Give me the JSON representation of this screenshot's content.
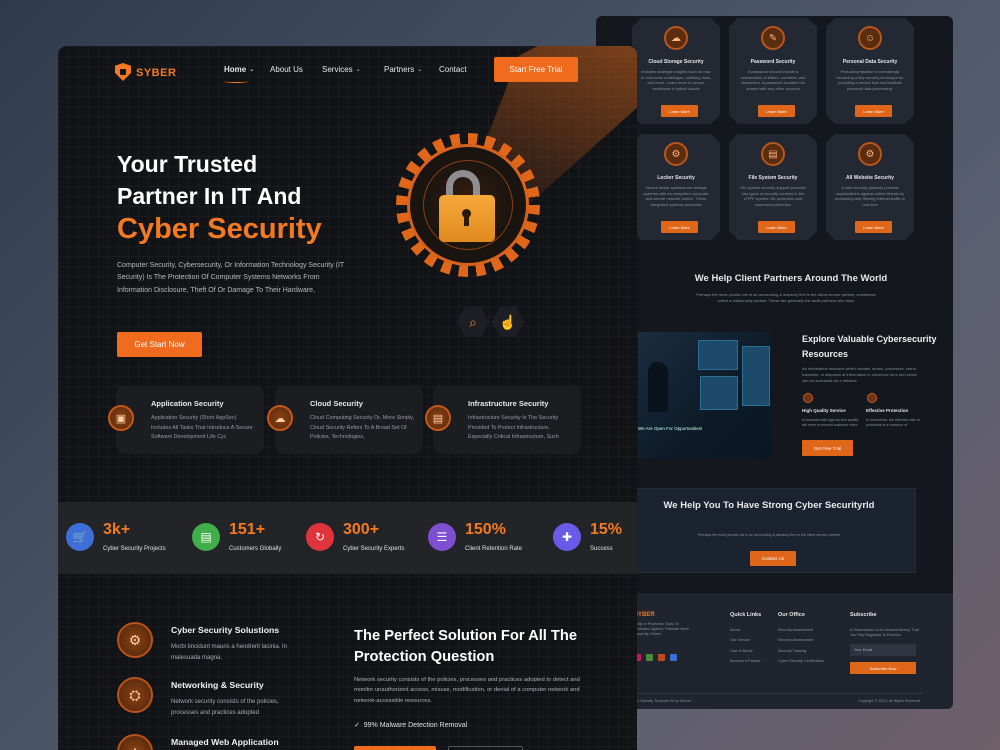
{
  "brand": {
    "name": "SYBER",
    "accent": "#f06b1e"
  },
  "nav": {
    "items": [
      "Home",
      "About Us",
      "Services",
      "Partners",
      "Contact"
    ],
    "cta": "Start Free Trial"
  },
  "hero": {
    "line1": "Your Trusted",
    "line2": "Partner In IT And",
    "line3": "Cyber Security",
    "description": "Computer Security, Cybersecurity, Or Information Technology Security (IT Security) Is The Protection Of Computer Systems Networks From Information Disclosure, Theft Of Or Damage To Their Hardware,",
    "cta": "Get Start Now",
    "icons": [
      "search-icon",
      "pointer-icon"
    ]
  },
  "features": [
    {
      "title": "Application Security",
      "desc": "Application Security (Short AppSec) Includes All Tasks That Introduce A Secure Software Development Life Cyc",
      "icon": "app-icon"
    },
    {
      "title": "Cloud Security",
      "desc": "Cloud Computing Security Or, More Simply, Cloud Security Refers To A Broad Set Of Policies, Technologies,",
      "icon": "cloud-icon"
    },
    {
      "title": "Infrastructure Security",
      "desc": "Infrastructure Security Is The Security Provided To Protect Infrastructure, Especially Critical Infrastructure, Such",
      "icon": "server-icon"
    }
  ],
  "stats": [
    {
      "value": "3k+",
      "label": "Cyber Security Projects",
      "color": "#3e6fd8",
      "icon": "cart-icon"
    },
    {
      "value": "151+",
      "label": "Customers Globally",
      "color": "#3fae4b",
      "icon": "document-icon"
    },
    {
      "value": "300+",
      "label": "Cyber Security Experts",
      "color": "#e0343d",
      "icon": "refresh-icon"
    },
    {
      "value": "150%",
      "label": "Client Retention Rate",
      "color": "#7e4fd0",
      "icon": "list-icon"
    },
    {
      "value": "15%",
      "label": "Success",
      "color": "#6a5ae8",
      "icon": "puzzle-icon"
    }
  ],
  "solutions": [
    {
      "title": "Cyber Security Solustions",
      "desc": "Morbi tincidunt mauris a hendrerit lacinia. In malesuada magna."
    },
    {
      "title": "Networking & Security",
      "desc": "Network security consists of the policies, processes and practices adopted"
    },
    {
      "title": "Managed Web Application",
      "desc": ""
    }
  ],
  "perfect": {
    "title": "The Perfect Solution For All The Protection Question",
    "desc": "Network security consists of the policies, processes and practices adopted to detect and monitor unauthorized access, misuse, modification, or denial of a computer network and network-accessible resources.",
    "check": "99% Malware Detection Removal"
  },
  "back": {
    "services": [
      {
        "title": "Cloud Storage Security",
        "desc": "Includes strategic insights such as how to overcome challenges, outlining risks, and more. Learn more to secure workloads in hybrid clouds"
      },
      {
        "title": "Password Security",
        "desc": "A password should include a combination of letters, numbers, and characters. A password shouldn't be shared with any other account"
      },
      {
        "title": "Personal Data Security",
        "desc": "Pseudonymisation is increasingly becoming a key security technique for providing a means that can facilitate personal data processing."
      },
      {
        "title": "Locker Security",
        "desc": "Secure locker systems are storage systems with an integrated computer and secure network built-in. These integrated systems automate"
      },
      {
        "title": "File System Security",
        "desc": "File system security support provides two types of security controls in the z/TPF system: file protection and command protection"
      },
      {
        "title": "All Website Security",
        "desc": "A web security gateway protects organizations against online threats by monitoring and filtering internet traffic in real time"
      }
    ],
    "learn_more": "Learn More",
    "partners_title": "We Help Client Partners Around The World",
    "partners_sub": "Perhaps the most pivotal role in an accounting & advisory firm is the client service partner, sometimes called a relationship partner. These are generally the audit partners who have",
    "explore": {
      "title": "Explore Valuable Cybersecurity Resources",
      "desc": "An information resource which creates, stores, processes, manu transmits, or disposes of information in electronic form and which can be accessed via a network",
      "f1": "High Quality Service",
      "f1d": "A business with high service quality will meet or exceed customer extre",
      "f2": "Effective Protection",
      "f2d": "In economics, the effective rate of protection is a measure of",
      "cta": "Get Free Trial",
      "img_text": "We Are Open For Opportunities!"
    },
    "strong": {
      "title": "We Help You To Have Strong Cyber Securityrld",
      "sub": "Perhaps the most pivotal role in an accounting & advisory firm is the client service partner",
      "cta": "Contact Us"
    },
    "footer": {
      "brand": "SYBER",
      "brand_desc": "curity or Protection Tools, Or Protection Against, Potential Harm aused By Others.",
      "quick": "Quick Links",
      "quick_items": [
        "About",
        "Our Service",
        "How It Works",
        "Become A Partner"
      ],
      "office": "Our Office",
      "office_items": [
        "Security Assessment",
        "Security Assessment",
        "Security Training",
        "Cyber Security Certification"
      ],
      "subscribe": "Subscribe",
      "sub_desc": "A Subscription Is An Amount Money That You Pay Regularly To Receive",
      "email_ph": "Your Email",
      "sub_btn": "Subscribe Now",
      "copy_left": "ber Security Template Kit by Shuvro",
      "copy_right": "Copyright © 2023 | All Rights Reserved"
    }
  }
}
